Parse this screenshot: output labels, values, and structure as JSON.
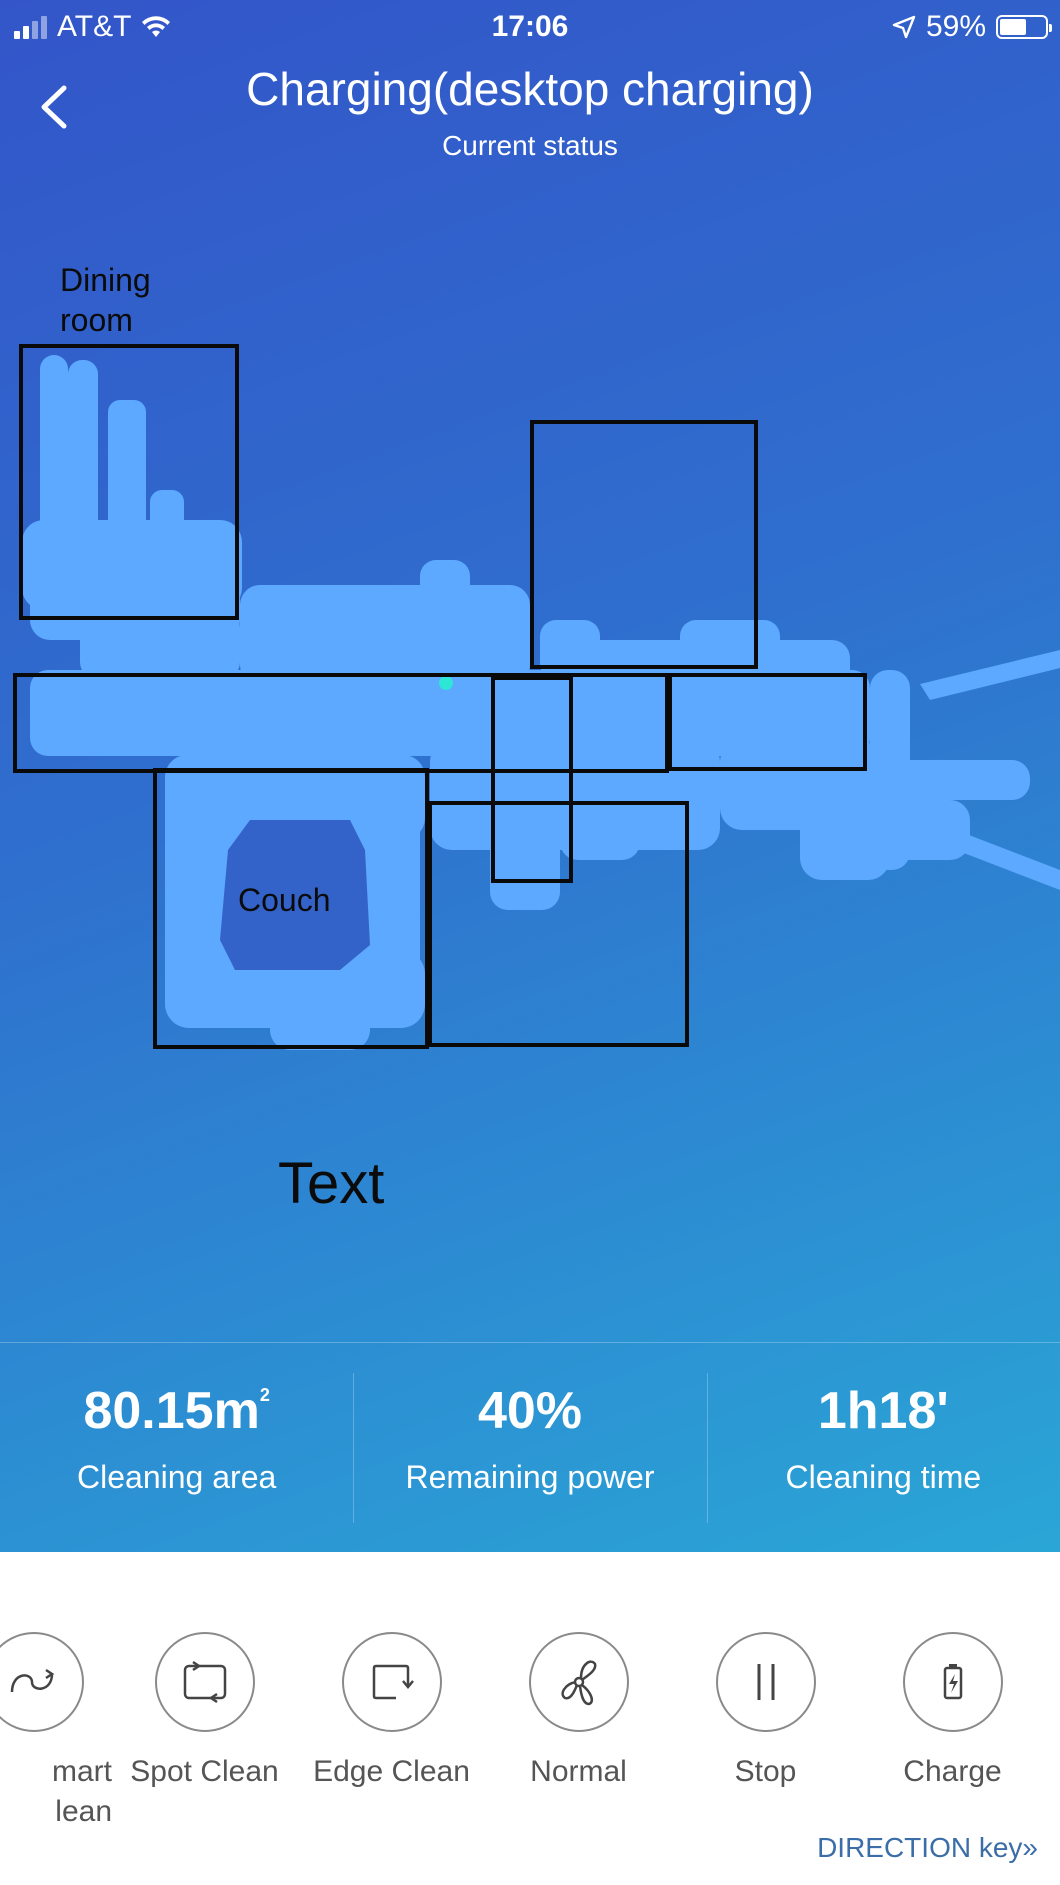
{
  "status_bar": {
    "carrier": "AT&T",
    "time": "17:06",
    "battery": "59%",
    "battery_level": 0.59
  },
  "header": {
    "title": "Charging(desktop charging)",
    "subtitle": "Current status"
  },
  "map": {
    "labels": {
      "dining_room": "Dining\nroom",
      "couch": "Couch",
      "text": "Text"
    },
    "colors": {
      "cleaned_area": "#5da9ff",
      "zone_border": "#0a0a0a",
      "robot_dot": "#2ee6d6"
    }
  },
  "stats": [
    {
      "value": "80.15m",
      "unit_sup": "2",
      "label": "Cleaning area"
    },
    {
      "value": "40%",
      "label": "Remaining power"
    },
    {
      "value": "1h18'",
      "label": "Cleaning time"
    }
  ],
  "controls": [
    {
      "label": "mart\nlean",
      "icon": "smart-clean-icon"
    },
    {
      "label": "Spot Clean",
      "icon": "spot-clean-icon"
    },
    {
      "label": "Edge Clean",
      "icon": "edge-clean-icon"
    },
    {
      "label": "Normal",
      "icon": "fan-icon"
    },
    {
      "label": "Stop",
      "icon": "pause-icon"
    },
    {
      "label": "Charge",
      "icon": "charge-icon"
    }
  ],
  "direction_key": "DIRECTION key»"
}
